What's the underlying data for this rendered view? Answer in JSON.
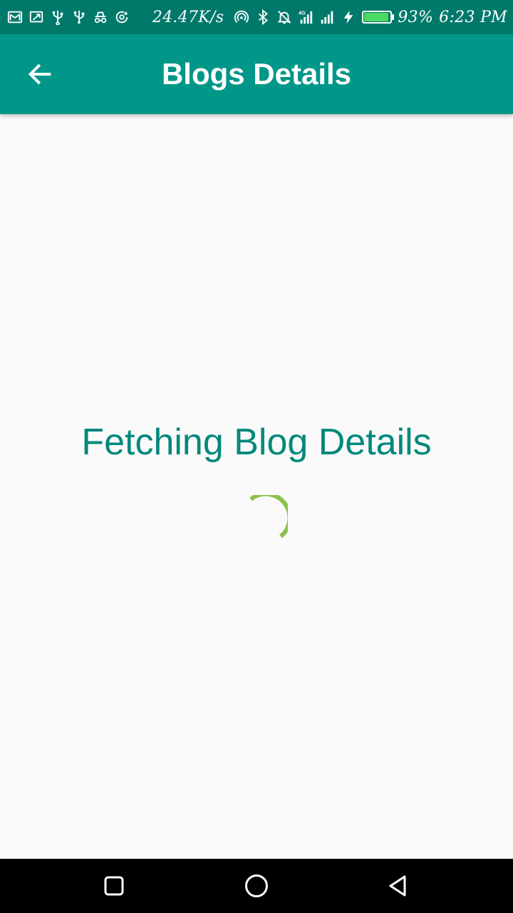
{
  "status_bar": {
    "left_icons": [
      "gmail-icon",
      "screen-cast-icon",
      "usb-icon",
      "usb-icon",
      "incognito-icon",
      "data-saver-icon"
    ],
    "network_speed": "24.47K/s",
    "right_icons": [
      "hotspot-icon",
      "bluetooth-icon",
      "notifications-off-icon",
      "signal-4g-icon",
      "signal-icon",
      "charging-bolt-icon",
      "battery-icon"
    ],
    "network_type": "4G",
    "battery_percent": "93%",
    "battery_level": 0.93,
    "time": "6:23 PM"
  },
  "app_bar": {
    "title": "Blogs Details",
    "back_icon": "arrow-back-icon"
  },
  "content": {
    "loading_text": "Fetching Blog Details",
    "spinner_icon": "circular-progress-spinner"
  },
  "nav_bar": {
    "buttons": [
      "recents-button",
      "home-button",
      "back-button"
    ]
  },
  "colors": {
    "status_bar": "#00796b",
    "app_bar": "#009688",
    "loading_text": "#00897b",
    "spinner": "#8bc34a",
    "battery_fill": "#4cd964",
    "background": "#fafafa",
    "nav_bar": "#000000"
  }
}
